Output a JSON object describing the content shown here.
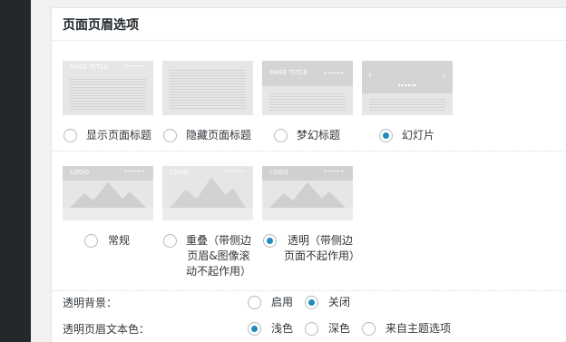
{
  "panel": {
    "title": "页面页眉选项"
  },
  "header_layouts": [
    {
      "label": "显示页面标题",
      "thumb_text": "PAGE TITLE",
      "selected": false
    },
    {
      "label": "隐藏页面标题",
      "thumb_text": "",
      "selected": false
    },
    {
      "label": "梦幻标题",
      "thumb_text": "PAGE TITLE",
      "selected": false
    },
    {
      "label": "幻灯片",
      "thumb_text": "",
      "selected": true
    }
  ],
  "header_styles": [
    {
      "label": "常规",
      "thumb_text": "LOGO",
      "selected": false
    },
    {
      "label": "重叠（带侧边页眉&图像滚动不起作用）",
      "thumb_text": "LOGO",
      "selected": false
    },
    {
      "label": "透明（带侧边页面不起作用）",
      "thumb_text": "LOGO",
      "selected": true
    }
  ],
  "transparent_bg": {
    "label": "透明背景：",
    "options": [
      {
        "label": "启用",
        "selected": false
      },
      {
        "label": "关闭",
        "selected": true
      }
    ]
  },
  "transparent_text": {
    "label": "透明页眉文本色：",
    "options": [
      {
        "label": "浅色",
        "selected": true
      },
      {
        "label": "深色",
        "selected": false
      },
      {
        "label": "来自主题选项",
        "selected": false
      }
    ]
  },
  "colors": {
    "accent": "#1e8cbe",
    "admin_bar": "#23282d"
  }
}
